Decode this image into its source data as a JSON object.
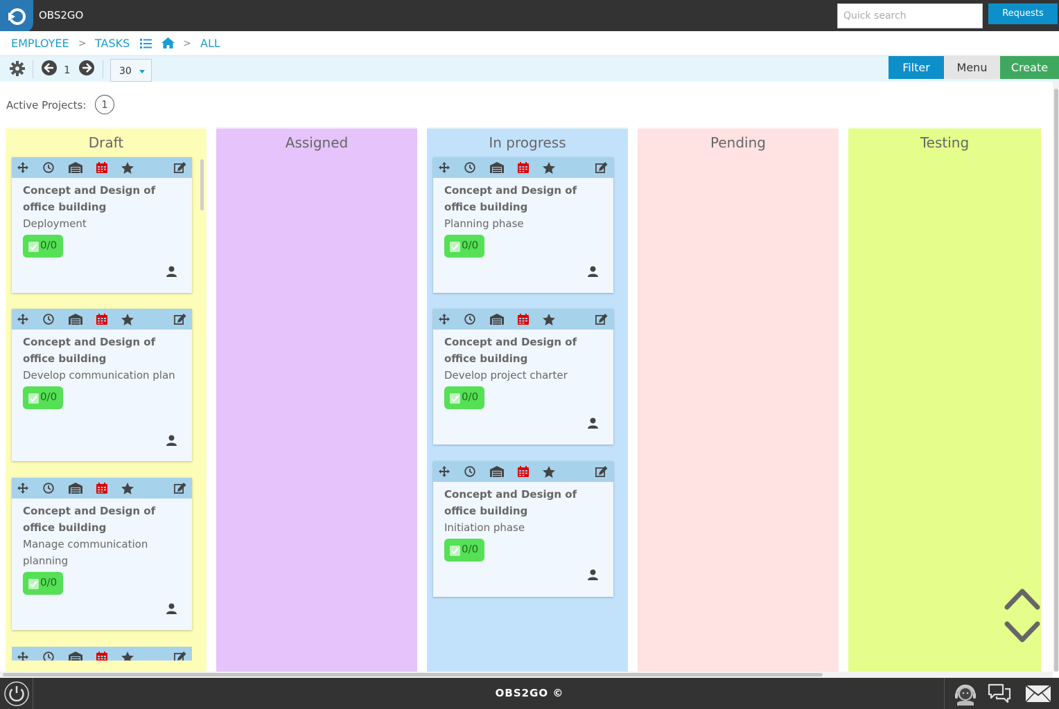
{
  "app": {
    "title": "OBS2GO"
  },
  "header": {
    "search_placeholder": "Quick search",
    "requests_label": "Requests"
  },
  "breadcrumb": {
    "employee": "EMPLOYEE",
    "sep1": ">",
    "tasks": "TASKS",
    "sep2": ">",
    "all": "ALL"
  },
  "toolbar": {
    "page": "1",
    "per_page": "30",
    "filter_label": "Filter",
    "menu_label": "Menu",
    "create_label": "Create"
  },
  "summary": {
    "active_projects_label": "Active Projects:",
    "active_projects_count": "1"
  },
  "columns": [
    {
      "title": "Draft",
      "color": "#fdfdb8",
      "cards": [
        {
          "project": "Concept and Design of office building",
          "task": "Deployment",
          "checklist": "0/0"
        },
        {
          "project": "Concept and Design of office building",
          "task": "Develop communication plan",
          "checklist": "0/0"
        },
        {
          "project": "Concept and Design of office building",
          "task": "Manage communication planning",
          "checklist": "0/0"
        }
      ]
    },
    {
      "title": "Assigned",
      "color": "#e6c3fb",
      "cards": []
    },
    {
      "title": "In progress",
      "color": "#c2e2fb",
      "cards": [
        {
          "project": "Concept and Design of office building",
          "task": "Planning phase",
          "checklist": "0/0"
        },
        {
          "project": "Concept and Design of office building",
          "task": "Develop project charter",
          "checklist": "0/0"
        },
        {
          "project": "Concept and Design of office building",
          "task": "Initiation phase",
          "checklist": "0/0"
        }
      ]
    },
    {
      "title": "Pending",
      "color": "#ffe2e1",
      "cards": []
    },
    {
      "title": "Testing",
      "color": "#e5fd8a",
      "cards": []
    }
  ],
  "card_tool_icons": [
    "move-icon",
    "clock-icon",
    "warehouse-icon",
    "calendar-icon",
    "star-icon",
    "edit-icon"
  ],
  "footer": {
    "text": "OBS2GO ©"
  },
  "colors": {
    "topbar": "#333333",
    "accent": "#0d8fc9",
    "create": "#3fa85f",
    "card_header": "#a7d2ec",
    "badge": "#55e055",
    "calendar_icon": "#e00000"
  }
}
